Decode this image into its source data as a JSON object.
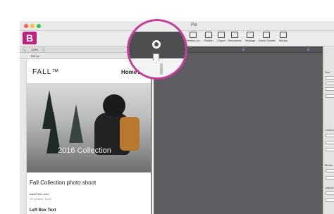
{
  "window": {
    "title": "Pa"
  },
  "logo": {
    "letter": "B"
  },
  "toolbar": {
    "items": [
      {
        "label": "Preview on...",
        "icon": "monitor-icon"
      },
      {
        "label": "Publish",
        "icon": "publish-icon"
      },
      {
        "label": "Export",
        "icon": "export-icon"
      },
      {
        "label": "Resources",
        "icon": "resources-icon"
      },
      {
        "label": "Settings",
        "icon": "settings-icon"
      },
      {
        "label": "Show Guides",
        "icon": "guides-icon"
      },
      {
        "label": "Modes",
        "icon": "modes-icon"
      }
    ]
  },
  "subbar": {
    "zoom": "100%",
    "width": "532 px"
  },
  "page": {
    "brand": "FALL™",
    "nav_home": "Home",
    "hero_text": "2016 Collection",
    "article_title": "Fall Collection photo shoot",
    "article_link": "www.FALL.com",
    "article_date": "10 October, 2016",
    "left_box_title": "Left Box Text"
  },
  "right_panel": {
    "labels": [
      "Text",
      "Conten",
      "Media",
      "Layout"
    ]
  },
  "colors": {
    "accent": "#c0207f",
    "magnifier_ring": "#c63c9c",
    "canvas": "#5e5e62"
  }
}
